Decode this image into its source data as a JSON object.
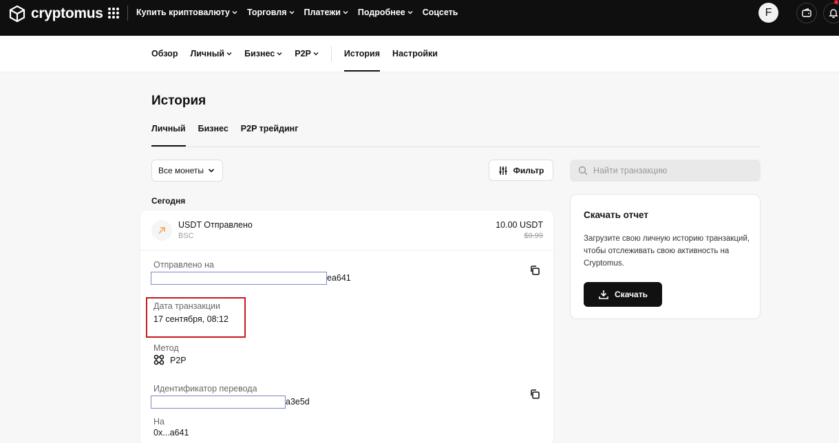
{
  "brand": {
    "name": "cryptomus"
  },
  "topnav": {
    "items": [
      {
        "label": "Купить криптовалюту",
        "dropdown": true
      },
      {
        "label": "Торговля",
        "dropdown": true
      },
      {
        "label": "Платежи",
        "dropdown": true
      },
      {
        "label": "Подробнее",
        "dropdown": true
      },
      {
        "label": "Соцсеть",
        "dropdown": false
      }
    ],
    "avatar_letter": "F"
  },
  "subnav": {
    "items": [
      {
        "label": "Обзор"
      },
      {
        "label": "Личный"
      },
      {
        "label": "Бизнес"
      },
      {
        "label": "P2P"
      },
      {
        "label": "История"
      },
      {
        "label": "Настройки"
      }
    ],
    "active": "История"
  },
  "page": {
    "title": "История",
    "tabs": [
      "Личный",
      "Бизнес",
      "P2P трейдинг"
    ],
    "active_tab": "Личный"
  },
  "filters": {
    "coin_select": "Все монеты",
    "filter_label": "Фильтр",
    "search_placeholder": "Найти транзакцию"
  },
  "history": {
    "day_label": "Сегодня",
    "transaction": {
      "title": "USDT Отправлено",
      "network": "BSC",
      "amount": "10.00 USDT",
      "usd_value": "$9.99",
      "details": {
        "sent_to_label": "Отправлено на",
        "sent_to_value_suffix": "ea641",
        "date_label": "Дата транзакции",
        "date_value": "17 сентября, 08:12",
        "method_label": "Метод",
        "method_value": "P2P",
        "transfer_id_label": "Идентификатор перевода",
        "transfer_id_suffix": "a3e5d",
        "to_label": "На",
        "to_value": "0x...a641"
      }
    }
  },
  "report": {
    "title": "Скачать отчет",
    "text": "Загрузите свою личную историю транзакций, чтобы отслеживать свою активность на Cryptomus.",
    "button_label": "Скачать"
  },
  "colors": {
    "topbar_bg": "#0f0f0f",
    "accent_orange": "#f0a868",
    "highlight_red": "#c8161d"
  }
}
